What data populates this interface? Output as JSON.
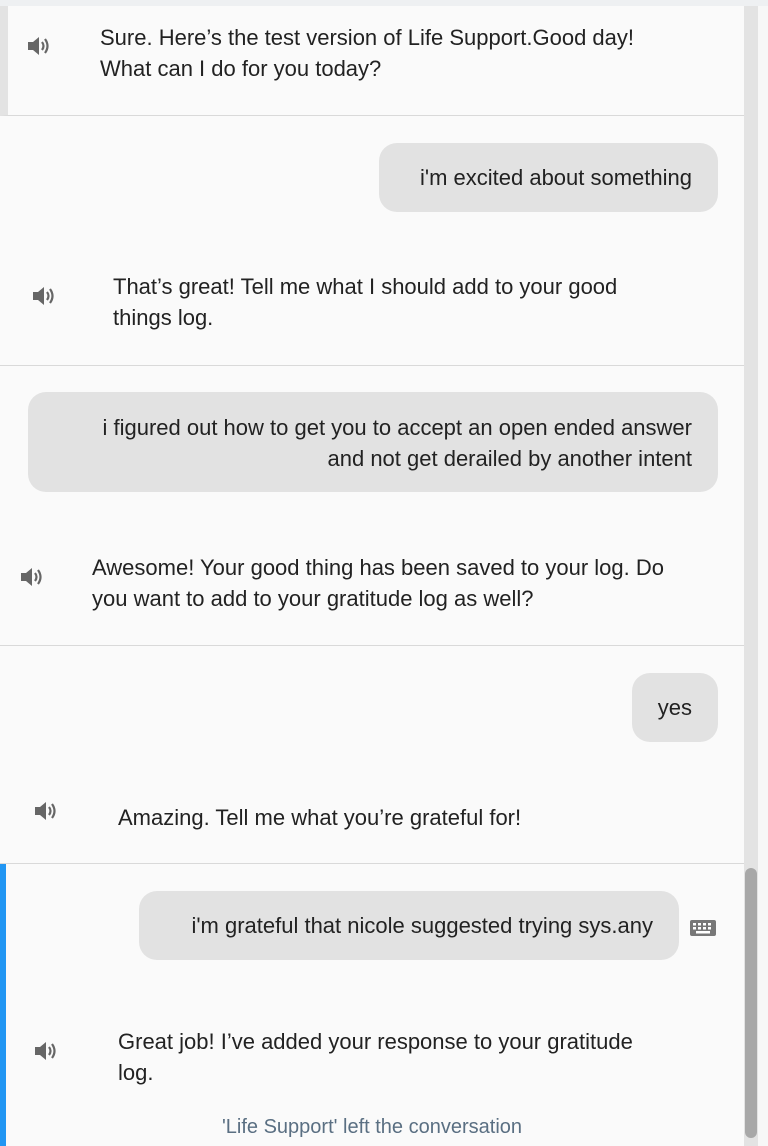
{
  "conversation": {
    "turns": [
      {
        "agent": {
          "line1": "Sure. Here’s the test version of Life Support.Good day!",
          "line2": "What can I do for you today?"
        }
      },
      {
        "user": {
          "line1": "i'm excited about something"
        },
        "agent": {
          "line1": "That’s great! Tell me what I should add to your good",
          "line2": "things log."
        }
      },
      {
        "user": {
          "line1": "i figured out how to get you to accept an open ended answer",
          "line2": "and not get derailed by another intent"
        },
        "agent": {
          "line1": "Awesome! Your good thing has been saved to your log. Do",
          "line2": "you want to add to your gratitude log as well?"
        }
      },
      {
        "user": {
          "line1": "yes"
        },
        "agent": {
          "line1": "Amazing. Tell me what you’re grateful for!"
        }
      },
      {
        "user": {
          "line1": "i'm grateful that nicole suggested trying sys.any"
        },
        "agent": {
          "line1": "Great job! I’ve added your response to your gratitude",
          "line2": "log."
        }
      }
    ],
    "footer_note": "'Life Support' left the conversation"
  },
  "icons": {
    "speaker": "speaker-icon",
    "keyboard": "keyboard-icon"
  },
  "colors": {
    "active_turn_accent": "#2196f3",
    "user_bubble": "#e2e2e2",
    "footer_note": "#5a6f82"
  }
}
